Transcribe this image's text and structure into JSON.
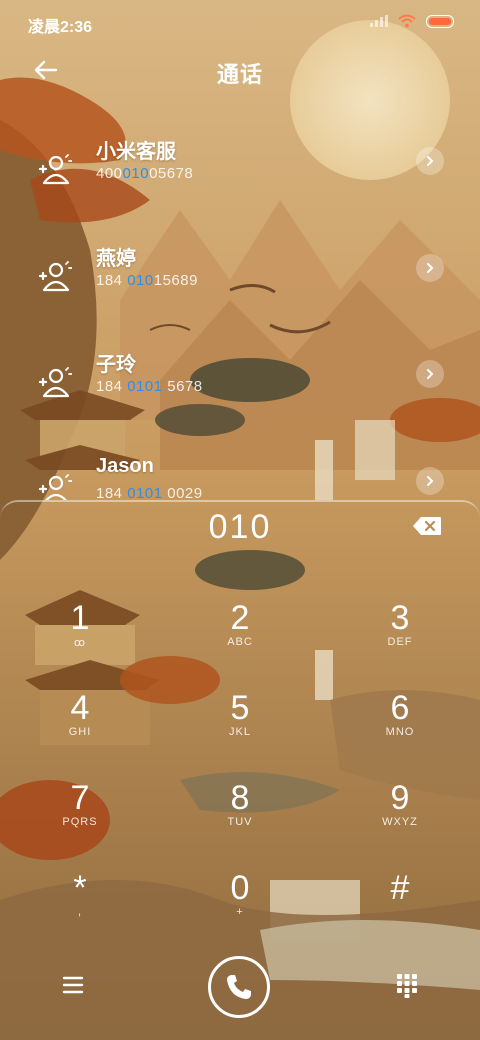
{
  "status_bar": {
    "time": "凌晨2:36"
  },
  "header": {
    "title": "通话"
  },
  "contacts": [
    {
      "name": "小米客服",
      "number_pre": "400",
      "number_match": "010",
      "number_post": "05678"
    },
    {
      "name": "燕婷",
      "number_pre": "184 ",
      "number_match": "010",
      "number_post": "15689"
    },
    {
      "name": "子玲",
      "number_pre": "184 ",
      "number_match": "0101",
      "number_post": " 5678"
    },
    {
      "name": "Jason",
      "number_pre": "184 ",
      "number_match": "0101",
      "number_post": " 0029"
    }
  ],
  "dialer": {
    "typed_number": "010",
    "keys": [
      {
        "digit": "1",
        "letters": "ꝏ"
      },
      {
        "digit": "2",
        "letters": "ABC"
      },
      {
        "digit": "3",
        "letters": "DEF"
      },
      {
        "digit": "4",
        "letters": "GHI"
      },
      {
        "digit": "5",
        "letters": "JKL"
      },
      {
        "digit": "6",
        "letters": "MNO"
      },
      {
        "digit": "7",
        "letters": "PQRS"
      },
      {
        "digit": "8",
        "letters": "TUV"
      },
      {
        "digit": "9",
        "letters": "WXYZ"
      },
      {
        "digit": "*",
        "letters": ","
      },
      {
        "digit": "0",
        "letters": "+"
      },
      {
        "digit": "#",
        "letters": ""
      }
    ]
  },
  "colors": {
    "match_highlight": "#2f8fe6",
    "battery": "#ff6a3c"
  },
  "icons": {
    "back": "arrow-left-icon",
    "contact": "contact-avatar-icon",
    "chevron": "chevron-right-icon",
    "backspace": "backspace-icon",
    "menu": "menu-icon",
    "call": "phone-icon",
    "dialpad": "dialpad-icon"
  }
}
